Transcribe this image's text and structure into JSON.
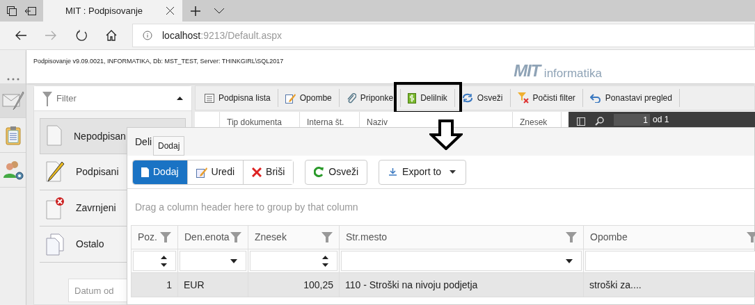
{
  "browser": {
    "tabs": [
      {
        "title": "MIT : Podpisovanje",
        "selected": true
      }
    ],
    "address": {
      "host": "localhost",
      "path": ":9213/Default.aspx"
    }
  },
  "app": {
    "version": "Podpisovanje v9.09.0021, INFORMATIKA, Db: MST_TEST, Server: THINKGIRL\\SQL2017",
    "logo": {
      "mark": "MIT",
      "text": "informatika"
    }
  },
  "rail": [
    {
      "kind": "mail",
      "selected": true
    },
    {
      "kind": "clipboard",
      "selected": false
    },
    {
      "kind": "users",
      "selected": false
    }
  ],
  "filter": {
    "title": "Filter",
    "expanded": true,
    "items": [
      {
        "kind": "blank",
        "label": "Nepodpisan",
        "selected": true
      },
      {
        "kind": "pencil",
        "label": "Podpisani",
        "selected": false
      },
      {
        "kind": "rejected",
        "label": "Zavrnjeni",
        "selected": false
      },
      {
        "kind": "copies",
        "label": "Ostalo",
        "selected": false
      }
    ],
    "date_from": {
      "placeholder": "Datum od"
    }
  },
  "toolbar": [
    {
      "kind": "list",
      "label": "Podpisna lista",
      "highlighted": false
    },
    {
      "kind": "note",
      "label": "Opombe",
      "highlighted": false
    },
    {
      "kind": "clip",
      "label": "Priponke",
      "highlighted": false
    },
    {
      "kind": "money",
      "label": "Delilnik",
      "highlighted": true
    },
    {
      "kind": "refresh",
      "label": "Osveži",
      "highlighted": false
    },
    {
      "kind": "clear",
      "label": "Počisti filter",
      "highlighted": false
    },
    {
      "kind": "undo",
      "label": "Ponastavi pregled",
      "highlighted": false
    }
  ],
  "grid": {
    "columns": [
      "Tip dokumenta",
      "Interna št.",
      "Naziv",
      "Znesek"
    ]
  },
  "pager": {
    "page": "1",
    "total": "od 1"
  },
  "dialog": {
    "title": "Deli",
    "tooltip": "Dodaj",
    "actions": [
      {
        "kind": "add",
        "label": "Dodaj",
        "selected": true
      },
      {
        "kind": "edit",
        "label": "Uredi",
        "selected": false
      },
      {
        "kind": "delete",
        "label": "Briši",
        "selected": false
      }
    ],
    "refresh": "Osveži",
    "export": "Export to",
    "group_hint": "Drag a column header here to group by that column",
    "columns": [
      {
        "label": "Poz.",
        "kind": "number"
      },
      {
        "label": "Den.enota",
        "kind": "list"
      },
      {
        "label": "Znesek",
        "kind": "number"
      },
      {
        "label": "Str.mesto",
        "kind": "list"
      },
      {
        "label": "Opombe",
        "kind": "text"
      }
    ],
    "rows": [
      {
        "selected": true,
        "cells": [
          "1",
          "EUR",
          "100,25",
          "110 - Stroški na nivoju podjetja",
          "stroški za...."
        ]
      }
    ]
  }
}
